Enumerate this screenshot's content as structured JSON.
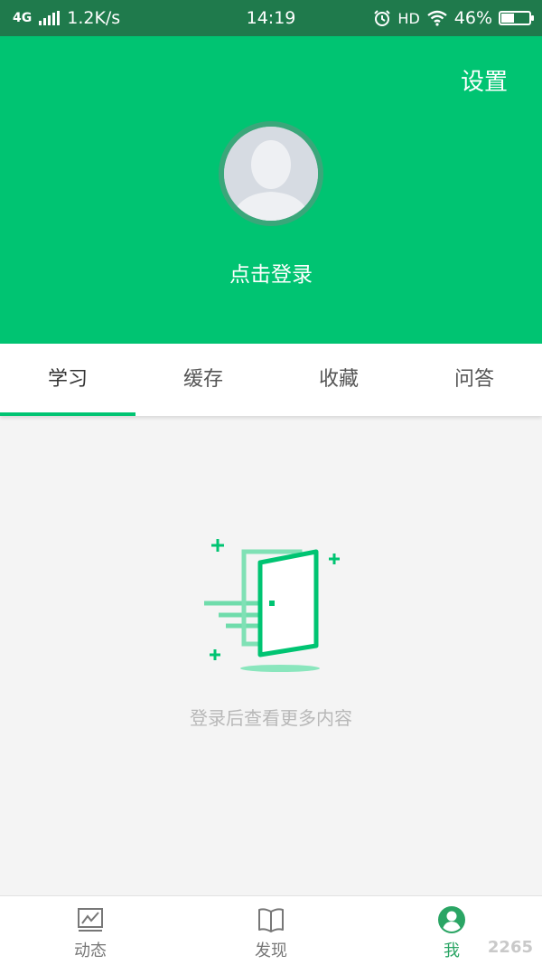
{
  "status_bar": {
    "network": "4G",
    "speed": "1.2K/s",
    "time": "14:19",
    "hd": "HD",
    "battery": "46%",
    "battery_level": 0.46
  },
  "header": {
    "settings_label": "设置",
    "login_label": "点击登录",
    "accent_color": "#00c472"
  },
  "tabs": [
    {
      "label": "学习",
      "active": true
    },
    {
      "label": "缓存",
      "active": false
    },
    {
      "label": "收藏",
      "active": false
    },
    {
      "label": "问答",
      "active": false
    }
  ],
  "empty_state": {
    "message": "登录后查看更多内容",
    "icon": "door-icon"
  },
  "bottom_nav": [
    {
      "label": "动态",
      "icon": "chart-icon",
      "active": false
    },
    {
      "label": "发现",
      "icon": "book-icon",
      "active": false
    },
    {
      "label": "我",
      "icon": "user-icon",
      "active": true
    }
  ],
  "watermark": "2265"
}
